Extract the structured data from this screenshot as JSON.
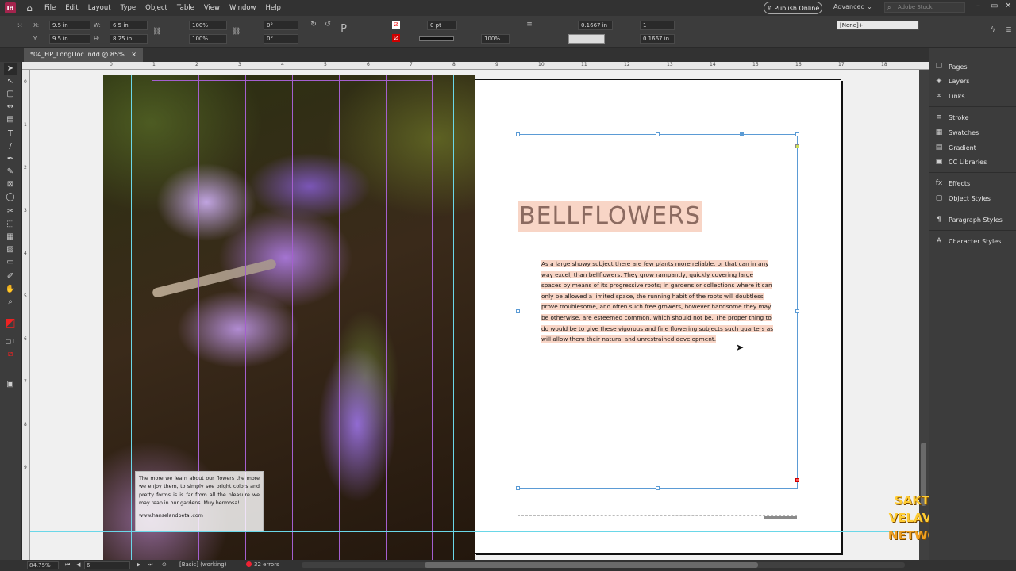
{
  "menubar": {
    "app_logo": "Id",
    "items": [
      "File",
      "Edit",
      "Layout",
      "Type",
      "Object",
      "Table",
      "View",
      "Window",
      "Help"
    ],
    "publish_label": "Publish Online",
    "workspace": "Advanced",
    "stock_placeholder": "Adobe Stock"
  },
  "control": {
    "x": "9.5 in",
    "y": "9.5 in",
    "w": "6.5 in",
    "h": "8.25 in",
    "scale_x": "100%",
    "scale_y": "100%",
    "rotate": "0°",
    "shear": "0°",
    "stroke_weight": "0 pt",
    "opacity": "100%",
    "inset1": "0.1667 in",
    "inset2": "0.1667 in",
    "columns": "1",
    "style": "[None]+"
  },
  "tab": {
    "title": "*04_HP_LongDoc.indd @ 85%",
    "close": "×"
  },
  "ruler": {
    "marks": [
      "0",
      "1",
      "2",
      "3",
      "4",
      "5",
      "6",
      "7",
      "8",
      "9",
      "10",
      "11",
      "12",
      "13",
      "14",
      "15",
      "16",
      "17",
      "18"
    ]
  },
  "ruler_v": {
    "marks": [
      "0",
      "1",
      "2",
      "3",
      "4",
      "5",
      "6",
      "7",
      "8",
      "9"
    ]
  },
  "caption": {
    "text": "The more we learn about our flowers the more we enjoy them, to simply see bright colors and pretty forms is is far from all the pleasure we may reap in our gardens. Muy hermosa!",
    "url": "www.hanselandpetal.com"
  },
  "article": {
    "heading": "BELLFLOWERS",
    "body": "As a large showy subject there are few plants more reliable, or that can in any way excel, than bellflowers. They grow rampantly, quickly covering large spaces by means of its progressive roots; in gardens or collections where it can only be allowed a limited space, the running habit of the roots will doubtless prove troublesome, and often such free growers, however handsome they may be otherwise, are esteemed common, which should not be. The proper thing to do would be to give these vigorous and fine flowering subjects such quarters as will allow them their natural and unrestrained development."
  },
  "panels": [
    {
      "label": "Pages",
      "icon": "pages-icon"
    },
    {
      "label": "Layers",
      "icon": "layers-icon"
    },
    {
      "label": "Links",
      "icon": "links-icon"
    },
    {
      "label": "Stroke",
      "icon": "stroke-icon"
    },
    {
      "label": "Swatches",
      "icon": "swatches-icon"
    },
    {
      "label": "Gradient",
      "icon": "gradient-icon"
    },
    {
      "label": "CC Libraries",
      "icon": "cc-libraries-icon"
    },
    {
      "label": "Effects",
      "icon": "effects-icon"
    },
    {
      "label": "Object Styles",
      "icon": "object-styles-icon"
    },
    {
      "label": "Paragraph Styles",
      "icon": "paragraph-styles-icon"
    },
    {
      "label": "Character Styles",
      "icon": "character-styles-icon"
    }
  ],
  "status": {
    "zoom": "84.75%",
    "page": "6",
    "style": "[Basic] (working)",
    "errors": "32 errors"
  },
  "watermark": {
    "line1": "SAKTHI VELAVAN",
    "line2": "NETWORKS"
  },
  "colors": {
    "heading_bg": "#f8d5c6",
    "heading_text": "#8b6a60",
    "frame": "#5b9bd5",
    "guide": "#6ad7e8",
    "margin": "#e7a7c8"
  }
}
